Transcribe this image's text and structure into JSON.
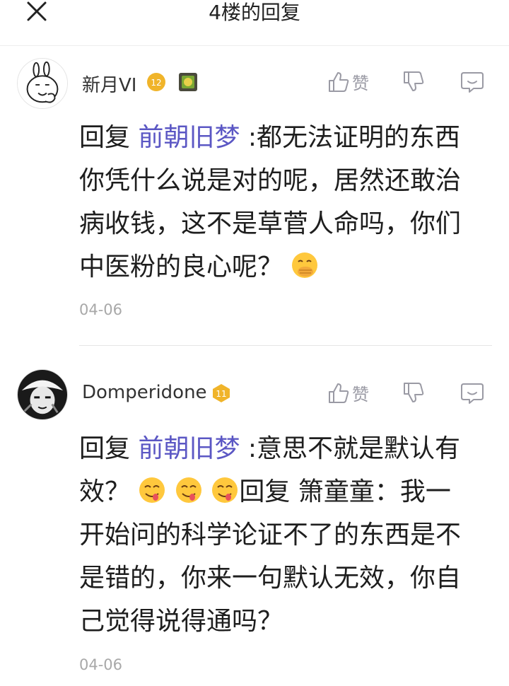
{
  "header": {
    "title": "4楼的回复",
    "close_icon": "close-icon"
  },
  "comments": [
    {
      "username": "新月VI",
      "level": "12",
      "like_label": "赞",
      "reply_prefix": "回复",
      "mention": "前朝旧梦",
      "text_1": "  :都无法证明的东西你凭什么说是对的呢，居然还敢治病收钱，这不是草菅人命吗，你们中医粉的良心呢？",
      "emoji": "hand-over-mouth-emoji",
      "date": "04-06"
    },
    {
      "username": "Domperidone",
      "level": "11",
      "like_label": "赞",
      "reply_prefix": "回复",
      "mention": "前朝旧梦",
      "text_1": "  :意思不就是默认有效？",
      "emoji": "yum-emoji",
      "text_2": "回复 箫童童：我一开始问的科学论证不了的东西是不是错的，你来一句默认无效，你自己觉得说得通吗？",
      "date": "04-06"
    }
  ],
  "colors": {
    "mention": "#5b57c4",
    "badge_gold": "#f0b42a",
    "icon_gray": "#9a9aa4"
  }
}
